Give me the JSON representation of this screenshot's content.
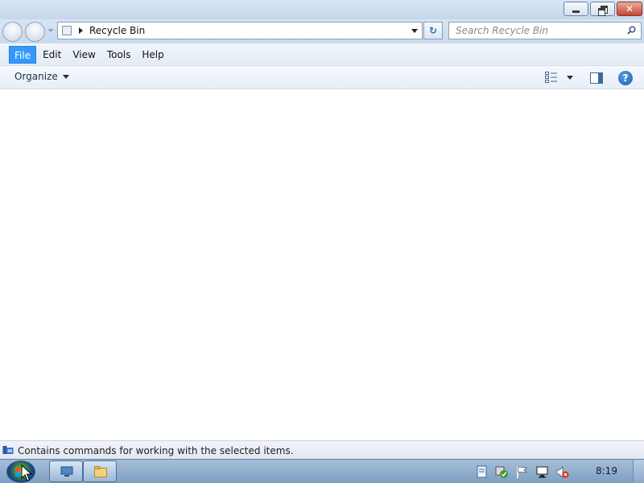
{
  "window": {
    "minimize_label": "",
    "maximize_label": "",
    "close_glyph": "✕"
  },
  "navigation": {
    "address": "Recycle Bin",
    "search_placeholder": "Search Recycle Bin",
    "refresh_glyph": "↻"
  },
  "menu": {
    "items": [
      {
        "label": "File",
        "active": true
      },
      {
        "label": "Edit",
        "active": false
      },
      {
        "label": "View",
        "active": false
      },
      {
        "label": "Tools",
        "active": false
      },
      {
        "label": "Help",
        "active": false
      }
    ]
  },
  "commandbar": {
    "organize_label": "Organize",
    "help_glyph": "?"
  },
  "statusbar": {
    "text": "Contains commands for working with the selected items."
  },
  "taskbar": {
    "clock": "8:19"
  },
  "icons": {
    "views": "views-icon",
    "preview_pane": "preview-pane-icon",
    "help": "help-icon",
    "search": "search-icon",
    "start": "windows-start-icon"
  },
  "colors": {
    "menu_active": "#3399ff",
    "taskbar": "#7d9fc2",
    "close_button": "#c8472f"
  }
}
